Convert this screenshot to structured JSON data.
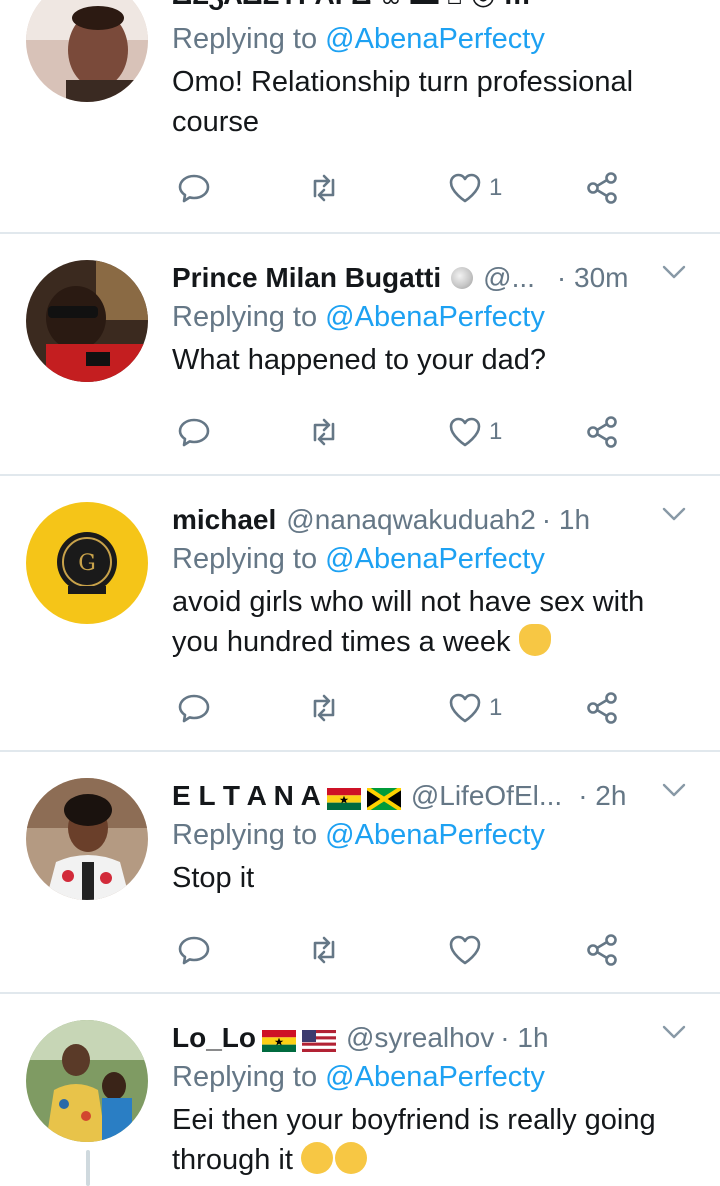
{
  "tweets": [
    {
      "name": "",
      "handle": "",
      "time": "",
      "replying_label": "Replying to",
      "replying_to": "@AbenaPerfecty",
      "text": "Omo! Relationship turn professional course",
      "likes": "1",
      "avatar_color": "#c9958a"
    },
    {
      "name": "Prince Milan Bugatti",
      "handle": "@...",
      "time": "· 30m",
      "replying_label": "Replying to",
      "replying_to": "@AbenaPerfecty",
      "text": "What happened to your dad?",
      "likes": "1",
      "avatar_color": "#5a3a28"
    },
    {
      "name": "michael",
      "handle": "@nanaqwakuduah2",
      "time": "· 1h",
      "replying_label": "Replying to",
      "replying_to": "@AbenaPerfecty",
      "text": "avoid girls who will not have sex with you hundred times a week",
      "likes": "1",
      "avatar_color": "#f5c518"
    },
    {
      "name": "E L T A N A",
      "handle": "@LifeOfEl...",
      "time": "· 2h",
      "replying_label": "Replying to",
      "replying_to": "@AbenaPerfecty",
      "text": "Stop it",
      "likes": "",
      "avatar_color": "#9c7f6a"
    },
    {
      "name": "Lo_Lo",
      "handle": "@syrealhov",
      "time": "· 1h",
      "replying_label": "Replying to",
      "replying_to": "@AbenaPerfecty",
      "text": "Eei then your boyfriend is really going through it",
      "likes": "",
      "avatar_color": "#6f8f5a"
    }
  ],
  "icons": {
    "reply": "reply-icon",
    "retweet": "retweet-icon",
    "like": "heart-icon",
    "share": "share-icon",
    "more": "chevron-down-icon"
  },
  "colors": {
    "link": "#1da1f2",
    "muted": "#657786",
    "divider": "#e1e8ed",
    "text": "#14171a"
  }
}
